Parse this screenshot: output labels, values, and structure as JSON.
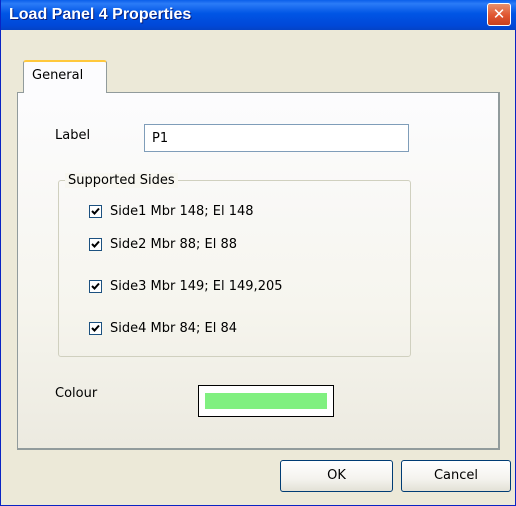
{
  "window": {
    "title": "Load Panel 4 Properties",
    "close_glyph": "✕"
  },
  "tabs": [
    {
      "label": "General"
    }
  ],
  "form": {
    "label_caption": "Label",
    "label_value": "P1",
    "supported_sides_title": "Supported Sides",
    "sides": [
      {
        "label": "Side1 Mbr 148; El 148",
        "checked": true
      },
      {
        "label": "Side2 Mbr 88; El 88",
        "checked": true
      },
      {
        "label": "Side3 Mbr 149; El 149,205",
        "checked": true
      },
      {
        "label": "Side4 Mbr 84; El 84",
        "checked": true
      }
    ],
    "colour_caption": "Colour",
    "colour_value": "#80F080"
  },
  "buttons": {
    "ok": "OK",
    "cancel": "Cancel"
  },
  "colors": {
    "title_bar": "#0055E5",
    "dialog_bg": "#ECE9D8",
    "close_button": "#E0552F",
    "tab_highlight": "#FFC83C"
  }
}
